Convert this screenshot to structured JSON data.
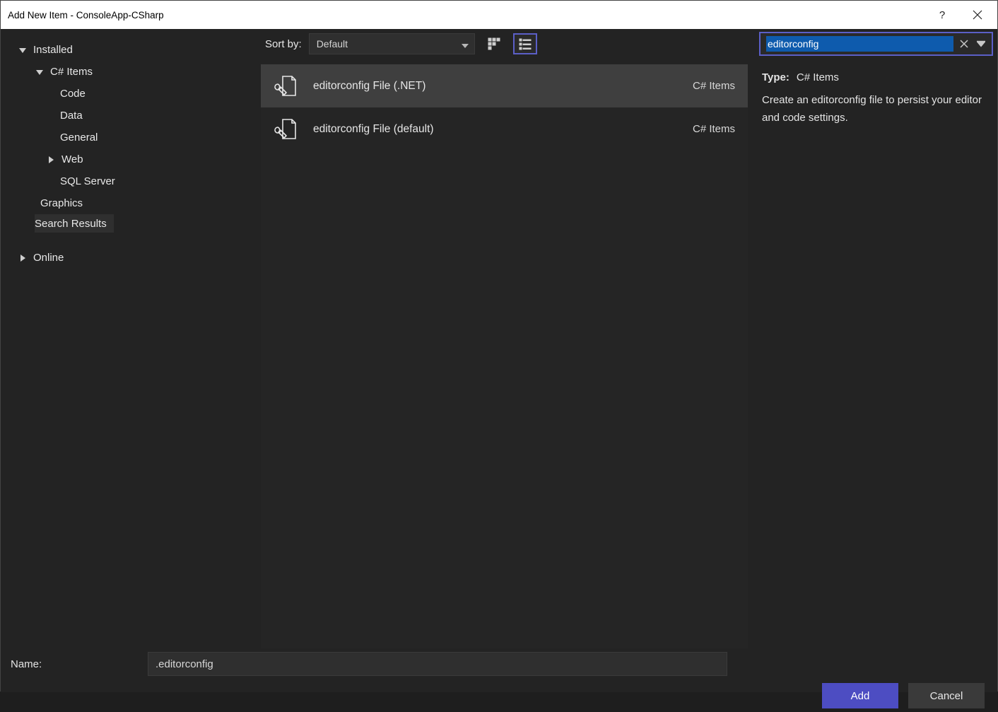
{
  "titlebar": {
    "title": "Add New Item - ConsoleApp-CSharp"
  },
  "sidebar": {
    "installed": "Installed",
    "csharp_items": "C# Items",
    "items": [
      "Code",
      "Data",
      "General",
      "Web",
      "SQL Server"
    ],
    "graphics": "Graphics",
    "search_results": "Search Results",
    "online": "Online"
  },
  "toolbar": {
    "sort_by_label": "Sort by:",
    "sort_by_value": "Default"
  },
  "items": [
    {
      "label": "editorconfig File (.NET)",
      "category": "C# Items"
    },
    {
      "label": "editorconfig File (default)",
      "category": "C# Items"
    }
  ],
  "search": {
    "value": "editorconfig"
  },
  "info": {
    "type_label": "Type:",
    "type_value": "C# Items",
    "description": "Create an editorconfig file to persist your editor and code settings."
  },
  "footer": {
    "name_label": "Name:",
    "name_value": ".editorconfig",
    "add_label": "Add",
    "cancel_label": "Cancel"
  }
}
